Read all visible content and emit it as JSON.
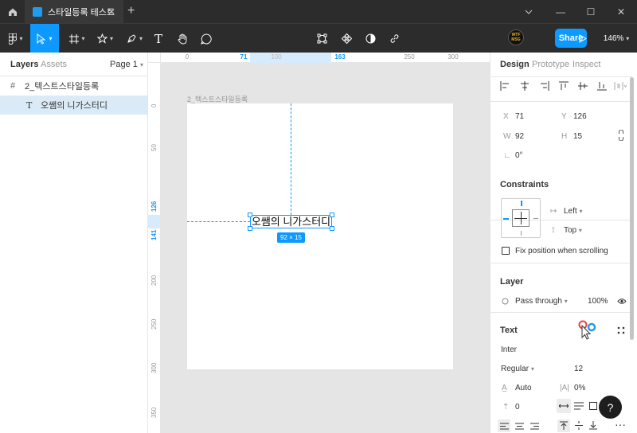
{
  "titlebar": {
    "tab_title": "스타일등록 테스트",
    "close_glyph": "✕",
    "plus_glyph": "+",
    "minimize_glyph": "—",
    "maximize_glyph": "☐",
    "window_close_glyph": "✕"
  },
  "toolbar": {
    "share_label": "Share",
    "zoom_label": "146%",
    "avatar_text": "WTF MSG"
  },
  "left_panel": {
    "tabs": [
      "Layers",
      "Assets"
    ],
    "page_label": "Page 1",
    "layers": [
      {
        "icon": "#",
        "label": "2_텍스트스타일등록"
      },
      {
        "icon": "T",
        "label": "오쌤의 니가스터디"
      }
    ]
  },
  "rulers": {
    "horizontal": [
      "0",
      "71",
      "100",
      "163",
      "250",
      "300"
    ],
    "vertical": [
      "0",
      "50",
      "126",
      "141",
      "200",
      "250",
      "300",
      "350"
    ]
  },
  "canvas": {
    "frame_label": "2_텍스트스타일등록",
    "text_content": "오쌤의 니가스터디",
    "size_badge": "92 × 15"
  },
  "right_panel": {
    "tabs": [
      "Design",
      "Prototype",
      "Inspect"
    ],
    "position": {
      "x_label": "X",
      "x": "71",
      "y_label": "Y",
      "y": "126",
      "w_label": "W",
      "w": "92",
      "h_label": "H",
      "h": "15",
      "rotation": "0°"
    },
    "constraints": {
      "title": "Constraints",
      "horizontal": "Left",
      "vertical": "Top",
      "fix_position": "Fix position when scrolling"
    },
    "layer": {
      "title": "Layer",
      "blend": "Pass through",
      "opacity": "100%"
    },
    "text": {
      "title": "Text",
      "font": "Inter",
      "weight": "Regular",
      "size": "12",
      "line_height": "Auto",
      "letter_spacing": "0%",
      "paragraph_spacing": "0"
    }
  },
  "help_label": "?"
}
